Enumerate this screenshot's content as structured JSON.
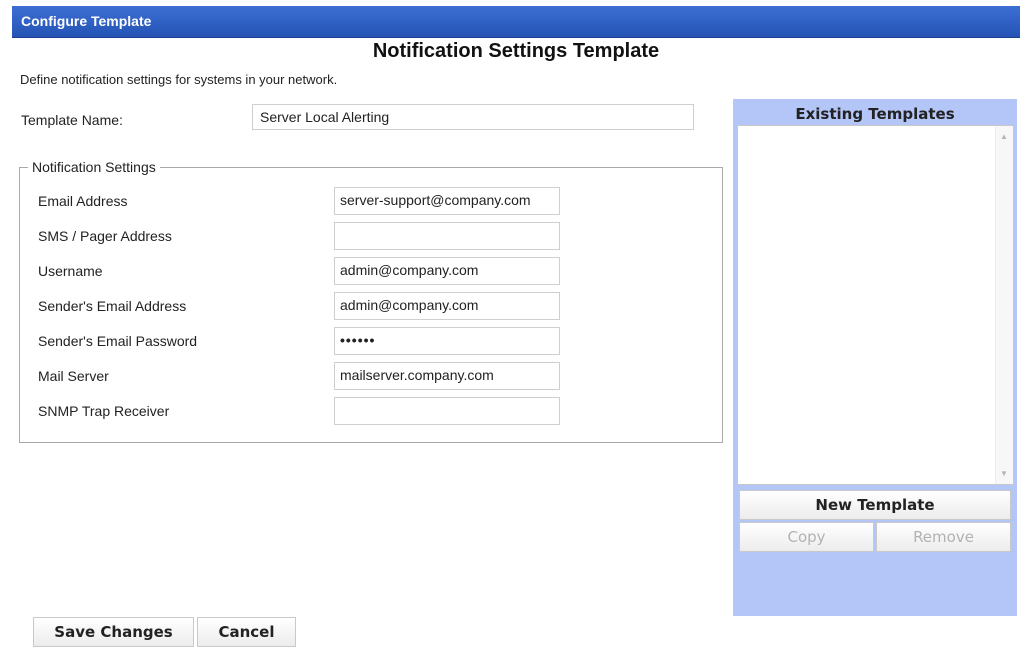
{
  "window": {
    "title": "Configure Template"
  },
  "page": {
    "title": "Notification Settings Template",
    "description": "Define notification settings for systems in your network."
  },
  "template_name": {
    "label": "Template Name:",
    "value": "Server Local Alerting"
  },
  "notification_settings": {
    "legend": "Notification Settings",
    "fields": [
      {
        "label": "Email Address",
        "value": "server-support@company.com"
      },
      {
        "label": "SMS / Pager Address",
        "value": ""
      },
      {
        "label": "Username",
        "value": "admin@company.com"
      },
      {
        "label": "Sender's Email Address",
        "value": "admin@company.com"
      },
      {
        "label": "Sender's Email Password",
        "value": "••••••"
      },
      {
        "label": "Mail Server",
        "value": "mailserver.company.com"
      },
      {
        "label": "SNMP Trap Receiver",
        "value": ""
      }
    ]
  },
  "existing_templates": {
    "title": "Existing Templates",
    "items": [],
    "new_label": "New Template",
    "copy_label": "Copy",
    "remove_label": "Remove"
  },
  "actions": {
    "save_label": "Save Changes",
    "cancel_label": "Cancel"
  },
  "colors": {
    "titlebar": "#2e5dc0",
    "sidepanel": "#b4c5f7",
    "disabled_text": "#b2b2b2"
  }
}
